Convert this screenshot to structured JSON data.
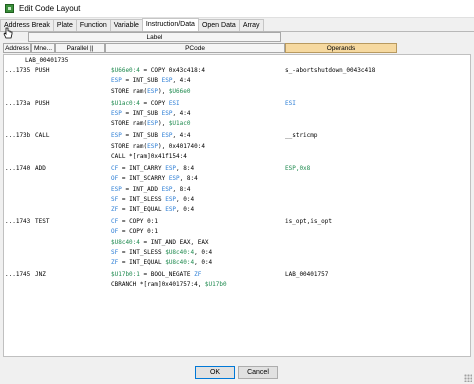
{
  "window": {
    "title": "Edit Code Layout"
  },
  "tabs": [
    "Address Break",
    "Plate",
    "Function",
    "Variable",
    "Instruction/Data",
    "Open Data",
    "Array"
  ],
  "headers": {
    "label": "Label",
    "address": "Address",
    "mnemonic": "Mne...",
    "parallel": "Parallel ||",
    "pcode": "PCode",
    "operands": "Operands"
  },
  "colors": {
    "varnode": "#1f8a4f",
    "register": "#2e7fd6",
    "text": "#000000"
  },
  "code": {
    "label": "LAB_00401735",
    "instructions": [
      {
        "addr": "...1735",
        "mne": "PUSH",
        "ops": "s_-abortshutdown_0043c418",
        "pcode": [
          [
            [
              "$U66e0:4",
              "v"
            ],
            [
              " = COPY 0x43c418:4",
              "t"
            ]
          ],
          [
            [
              "ESP",
              "r"
            ],
            [
              " = INT_SUB ",
              "t"
            ],
            [
              "ESP",
              "r"
            ],
            [
              ", 4:4",
              "t"
            ]
          ],
          [
            [
              "STORE ram(",
              "t"
            ],
            [
              "ESP",
              "r"
            ],
            [
              "), ",
              "t"
            ],
            [
              "$U66e0",
              "v"
            ]
          ]
        ]
      },
      {
        "addr": "...173a",
        "mne": "PUSH",
        "ops": "ESI",
        "pcode": [
          [
            [
              "$U1ac0:4",
              "v"
            ],
            [
              " = COPY ",
              "t"
            ],
            [
              "ESI",
              "r"
            ]
          ],
          [
            [
              "ESP",
              "r"
            ],
            [
              " = INT_SUB ",
              "t"
            ],
            [
              "ESP",
              "r"
            ],
            [
              ", 4:4",
              "t"
            ]
          ],
          [
            [
              "STORE ram(",
              "t"
            ],
            [
              "ESP",
              "r"
            ],
            [
              "), ",
              "t"
            ],
            [
              "$U1ac0",
              "v"
            ]
          ]
        ]
      },
      {
        "addr": "...173b",
        "mne": "CALL",
        "ops": "__stricmp",
        "pcode": [
          [
            [
              "ESP",
              "r"
            ],
            [
              " = INT_SUB ",
              "t"
            ],
            [
              "ESP",
              "r"
            ],
            [
              ", 4:4",
              "t"
            ]
          ],
          [
            [
              "STORE ram(",
              "t"
            ],
            [
              "ESP",
              "r"
            ],
            [
              "), 0x401740:4",
              "t"
            ]
          ],
          [
            [
              "CALL *[ram]0x41f154:4",
              "t"
            ]
          ]
        ]
      },
      {
        "addr": "...1740",
        "mne": "ADD",
        "ops": "ESP,0x8",
        "pcode": [
          [
            [
              "CF",
              "r"
            ],
            [
              " = INT_CARRY ",
              "t"
            ],
            [
              "ESP",
              "r"
            ],
            [
              ", 8:4",
              "t"
            ]
          ],
          [
            [
              "OF",
              "r"
            ],
            [
              " = INT_SCARRY ",
              "t"
            ],
            [
              "ESP",
              "r"
            ],
            [
              ", 8:4",
              "t"
            ]
          ],
          [
            [
              "ESP",
              "r"
            ],
            [
              " = INT_ADD ",
              "t"
            ],
            [
              "ESP",
              "r"
            ],
            [
              ", 8:4",
              "t"
            ]
          ],
          [
            [
              "SF",
              "r"
            ],
            [
              " = INT_SLESS ",
              "t"
            ],
            [
              "ESP",
              "r"
            ],
            [
              ", 0:4",
              "t"
            ]
          ],
          [
            [
              "ZF",
              "r"
            ],
            [
              " = INT_EQUAL ",
              "t"
            ],
            [
              "ESP",
              "r"
            ],
            [
              ", 0:4",
              "t"
            ]
          ]
        ]
      },
      {
        "addr": "...1743",
        "mne": "TEST",
        "ops": "is_opt,is_opt",
        "pcode": [
          [
            [
              "CF",
              "r"
            ],
            [
              " = COPY 0:1",
              "t"
            ]
          ],
          [
            [
              "OF",
              "r"
            ],
            [
              " = COPY 0:1",
              "t"
            ]
          ],
          [
            [
              "$U8c40:4",
              "v"
            ],
            [
              " = INT_AND EAX, EAX",
              "t"
            ]
          ],
          [
            [
              "SF",
              "r"
            ],
            [
              " = INT_SLESS ",
              "t"
            ],
            [
              "$U8c40:4",
              "v"
            ],
            [
              ", 0:4",
              "t"
            ]
          ],
          [
            [
              "ZF",
              "r"
            ],
            [
              " = INT_EQUAL ",
              "t"
            ],
            [
              "$U8c40:4",
              "v"
            ],
            [
              ", 0:4",
              "t"
            ]
          ]
        ]
      },
      {
        "addr": "...1745",
        "mne": "JNZ",
        "ops": "LAB_00401757",
        "pcode": [
          [
            [
              "$U17b0:1",
              "v"
            ],
            [
              " = BOOL_NEGATE ",
              "t"
            ],
            [
              "ZF",
              "r"
            ]
          ],
          [
            [
              "CBRANCH *[ram]0x401757:4, ",
              "t"
            ],
            [
              "$U17b0",
              "v"
            ]
          ]
        ]
      }
    ]
  },
  "buttons": {
    "ok": "OK",
    "cancel": "Cancel"
  }
}
